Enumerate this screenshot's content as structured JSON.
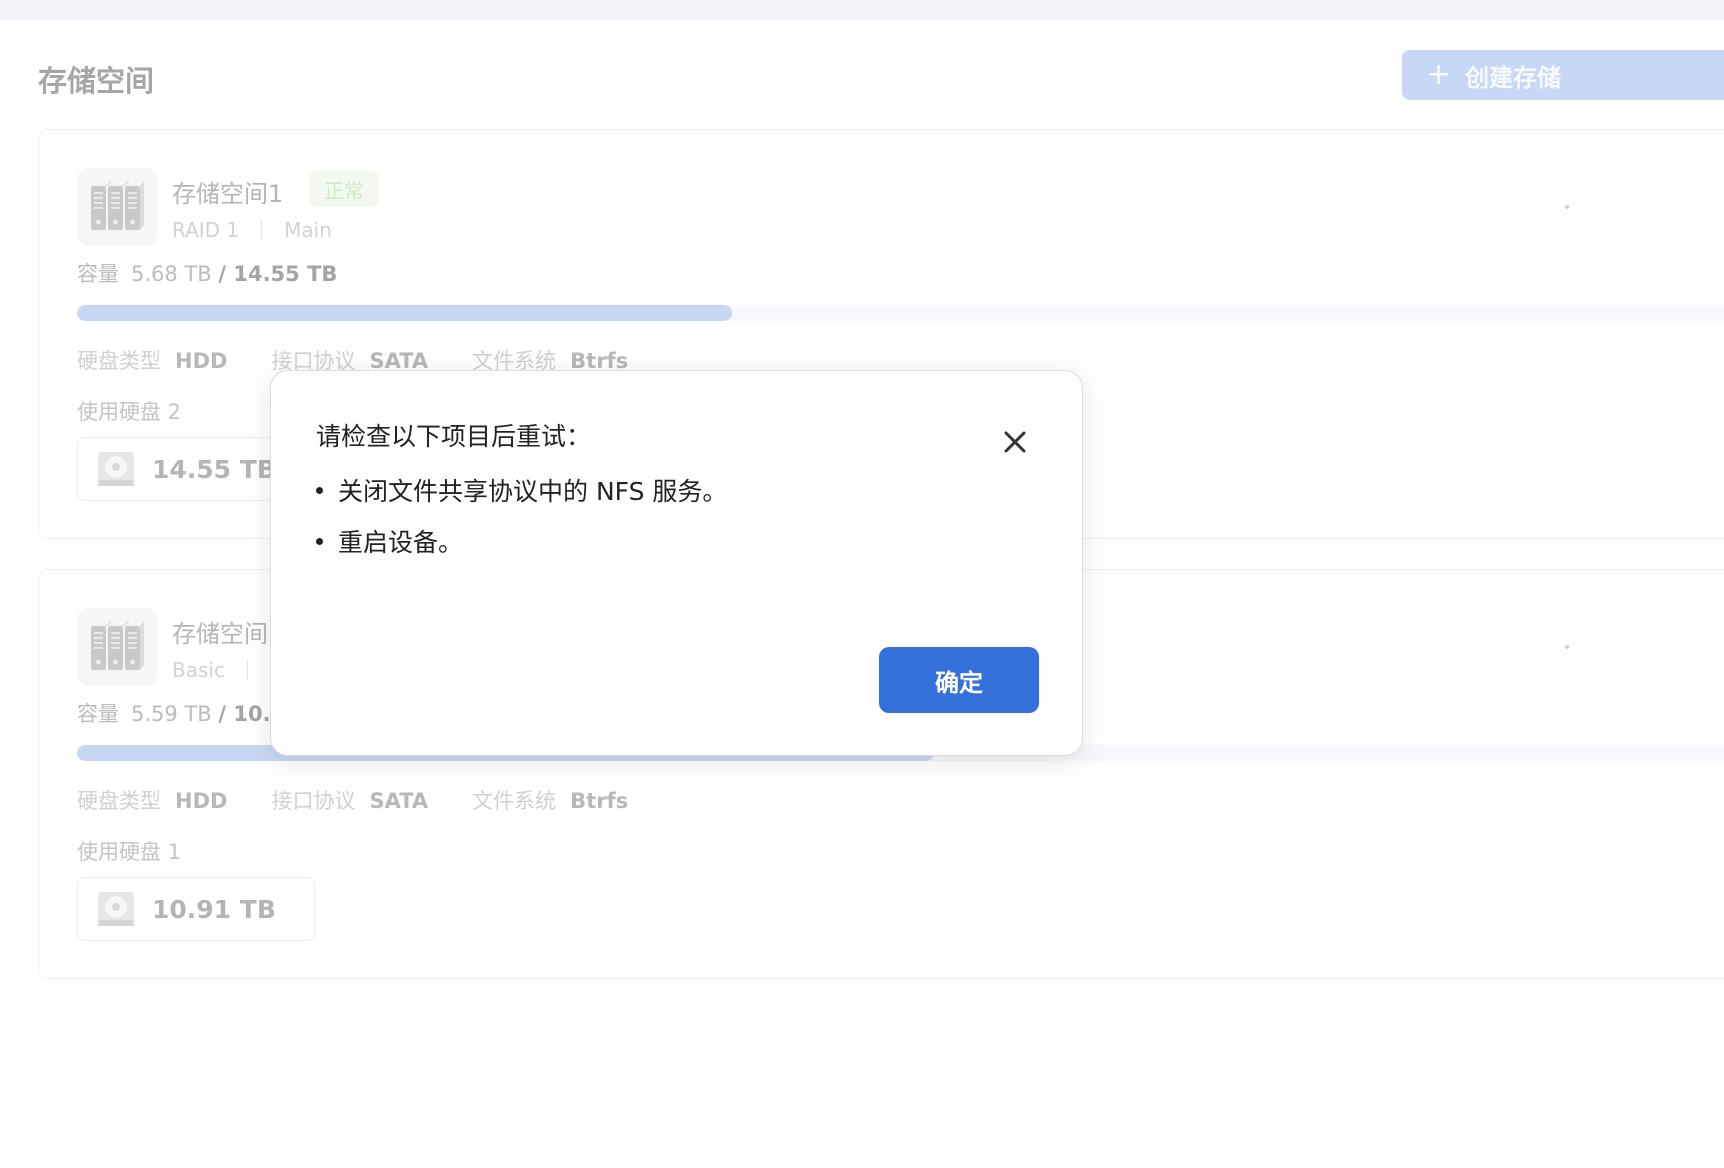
{
  "page": {
    "title": "存储空间",
    "create_button": {
      "icon": "plus-icon",
      "label": "创建存储"
    }
  },
  "pools": [
    {
      "name": "存储空间1",
      "status": "正常",
      "raid": "RAID 1",
      "volume": "Main",
      "capacity_label": "容量",
      "used": "5.68 TB",
      "total": "/ 14.55 TB",
      "usage_fraction": 0.39,
      "attrs": [
        {
          "label": "硬盘类型",
          "value": "HDD"
        },
        {
          "label": "接口协议",
          "value": "SATA"
        },
        {
          "label": "文件系统",
          "value": "Btrfs"
        }
      ],
      "disks_label": "使用硬盘 2",
      "disks": [
        "14.55 TB"
      ]
    },
    {
      "name": "存储空间",
      "raid": "Basic",
      "capacity_label": "容量",
      "used": "5.59 TB",
      "total": "/ 10.9",
      "usage_fraction": 0.51,
      "attrs": [
        {
          "label": "硬盘类型",
          "value": "HDD"
        },
        {
          "label": "接口协议",
          "value": "SATA"
        },
        {
          "label": "文件系统",
          "value": "Btrfs"
        }
      ],
      "disks_label": "使用硬盘 1",
      "disks": [
        "10.91 TB"
      ]
    }
  ],
  "dialog": {
    "title": "请检查以下项目后重试：",
    "items": [
      "关闭文件共享协议中的 NFS 服务。",
      "重启设备。"
    ],
    "confirm_label": "确定",
    "close_icon": "close-icon"
  },
  "colors": {
    "accent": "#3370d9",
    "create_button_bg": "#c7d8f6",
    "progress_fill": "#c8d7f3"
  }
}
